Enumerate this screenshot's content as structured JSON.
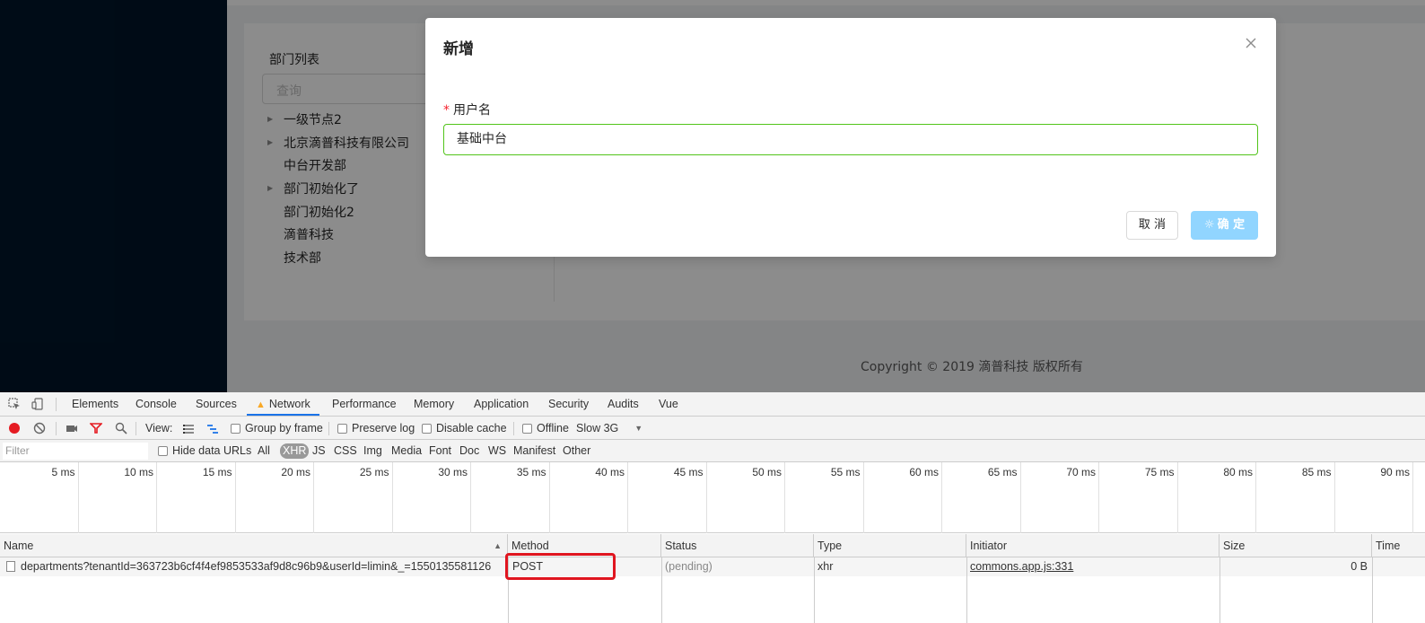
{
  "sidebar": {
    "label": ""
  },
  "department_panel": {
    "title": "部门列表",
    "search_placeholder": "查询",
    "tree": [
      {
        "label": "一级节点2",
        "expandable": true
      },
      {
        "label": "北京滴普科技有限公司",
        "expandable": true
      },
      {
        "label": "中台开发部",
        "expandable": false
      },
      {
        "label": "部门初始化了",
        "expandable": true
      },
      {
        "label": "部门初始化2",
        "expandable": false
      },
      {
        "label": "滴普科技",
        "expandable": false
      },
      {
        "label": "技术部",
        "expandable": false
      }
    ]
  },
  "footer": {
    "copyright": "Copyright © 2019 滴普科技 版权所有"
  },
  "modal": {
    "title": "新增",
    "close_icon": "close-icon",
    "field_required_mark": "*",
    "field_label": "用户名",
    "field_value": "基础中台",
    "cancel_label": "取 消",
    "ok_label": "确 定",
    "ok_loading_icon": "☼"
  },
  "devtools": {
    "tabs": [
      "Elements",
      "Console",
      "Sources",
      "Network",
      "Performance",
      "Memory",
      "Application",
      "Security",
      "Audits",
      "Vue"
    ],
    "active_tab": "Network",
    "toolbar": {
      "view_label": "View:",
      "group_by_frame": "Group by frame",
      "preserve_log": "Preserve log",
      "disable_cache": "Disable cache",
      "offline": "Offline",
      "throttle": "Slow 3G"
    },
    "filter": {
      "placeholder": "Filter",
      "hide_data_urls": "Hide data URLs",
      "types": [
        "All",
        "XHR",
        "JS",
        "CSS",
        "Img",
        "Media",
        "Font",
        "Doc",
        "WS",
        "Manifest",
        "Other"
      ],
      "active_type": "XHR"
    },
    "timeline_ticks": [
      "5 ms",
      "10 ms",
      "15 ms",
      "20 ms",
      "25 ms",
      "30 ms",
      "35 ms",
      "40 ms",
      "45 ms",
      "50 ms",
      "55 ms",
      "60 ms",
      "65 ms",
      "70 ms",
      "75 ms",
      "80 ms",
      "85 ms",
      "90 ms"
    ],
    "table": {
      "headers": [
        "Name",
        "Method",
        "Status",
        "Type",
        "Initiator",
        "Size",
        "Time"
      ],
      "rows": [
        {
          "name": "departments?tenantId=363723b6cf4f4ef9853533af9d8c96b9&userId=limin&_=1550135581126",
          "method": "POST",
          "status": "(pending)",
          "type": "xhr",
          "initiator": "commons.app.js:331",
          "size": "0 B",
          "time": ""
        }
      ]
    }
  },
  "colors": {
    "sider": "#001529",
    "input_border_success": "#52c41a",
    "primary_loading": "#91d5ff",
    "highlight_box": "#e0151f",
    "devtools_active_tab": "#1a73e8"
  }
}
